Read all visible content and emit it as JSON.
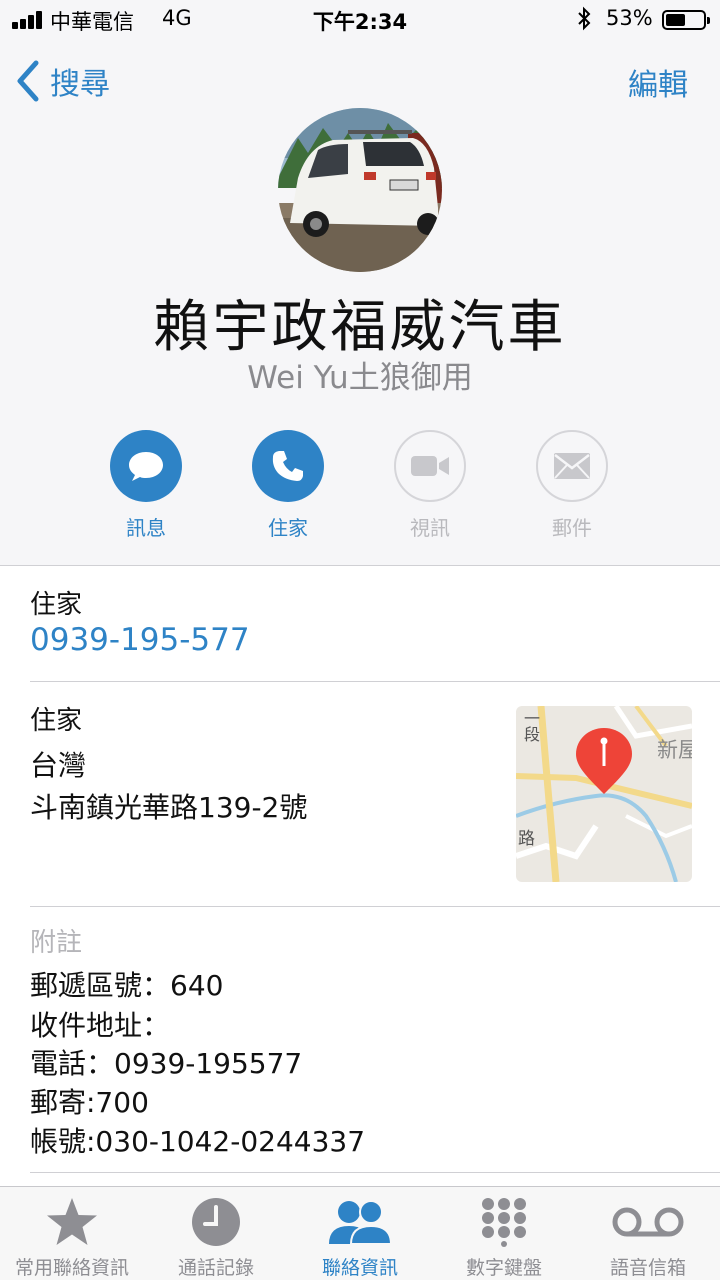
{
  "status_bar": {
    "carrier": "中華電信",
    "network": "4G",
    "time": "下午2:34",
    "battery": "53%",
    "battery_level": 0.53
  },
  "nav": {
    "back_label": "搜尋",
    "edit_label": "編輯"
  },
  "contact": {
    "name": "賴宇政福威汽車",
    "subtitle": "Wei Yu土狼御用"
  },
  "actions": [
    {
      "label": "訊息",
      "icon": "message-icon",
      "enabled": true
    },
    {
      "label": "住家",
      "icon": "phone-icon",
      "enabled": true
    },
    {
      "label": "視訊",
      "icon": "video-icon",
      "enabled": false
    },
    {
      "label": "郵件",
      "icon": "mail-icon",
      "enabled": false
    }
  ],
  "phone": {
    "label": "住家",
    "number": "0939-195-577"
  },
  "address": {
    "label": "住家",
    "lines": [
      "台灣",
      "斗南鎮光華路139-2號"
    ],
    "map_labels": [
      "一段",
      "新屋",
      "路"
    ]
  },
  "notes": {
    "label": "附註",
    "lines": [
      "郵遞區號：640",
      "收件地址：",
      "電話：0939-195577",
      "郵寄:700",
      "帳號:030-1042-0244337"
    ]
  },
  "tabbar": {
    "tabs": [
      {
        "label": "常用聯絡資訊",
        "icon": "star-icon",
        "active": false
      },
      {
        "label": "通話記錄",
        "icon": "clock-icon",
        "active": false
      },
      {
        "label": "聯絡資訊",
        "icon": "contacts-icon",
        "active": true
      },
      {
        "label": "數字鍵盤",
        "icon": "keypad-icon",
        "active": false
      },
      {
        "label": "語音信箱",
        "icon": "voicemail-icon",
        "active": false
      }
    ]
  },
  "colors": {
    "accent": "#2e83c6",
    "disabled": "#b9b9bd",
    "header_bg": "#f6f6f8",
    "map_pin": "#ee4438"
  }
}
